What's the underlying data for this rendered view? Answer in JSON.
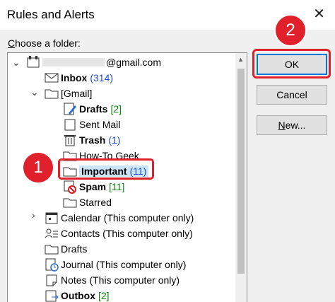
{
  "window": {
    "title": "Rules and Alerts"
  },
  "choose_label": {
    "text_underlined": "C",
    "text_rest": "hoose a folder:"
  },
  "tree": {
    "account": {
      "suffix": "@gmail.com"
    },
    "inbox": {
      "label": "Inbox",
      "count": "(314)"
    },
    "gmail": {
      "label": "[Gmail]"
    },
    "drafts_gmail": {
      "label": "Drafts",
      "count": "[2]"
    },
    "sent_mail": {
      "label": "Sent Mail"
    },
    "trash": {
      "label": "Trash",
      "count": "(1)"
    },
    "howtogeek": {
      "label": "How-To Geek"
    },
    "important": {
      "label": "Important",
      "count": "(11)"
    },
    "spam": {
      "label": "Spam",
      "count": "[11]"
    },
    "starred": {
      "label": "Starred"
    },
    "calendar": {
      "label": "Calendar (This computer only)"
    },
    "contacts": {
      "label": "Contacts (This computer only)"
    },
    "drafts": {
      "label": "Drafts"
    },
    "journal": {
      "label": "Journal (This computer only)"
    },
    "notes": {
      "label": "Notes (This computer only)"
    },
    "outbox": {
      "label": "Outbox",
      "count": "[2]"
    }
  },
  "buttons": {
    "ok": "OK",
    "cancel": "Cancel",
    "new_underlined": "N",
    "new_rest": "ew..."
  },
  "callouts": {
    "one": "1",
    "two": "2"
  },
  "colors": {
    "highlight_red": "#e0202a",
    "count_blue": "#1a4fd6",
    "count_green": "#0a8a0a",
    "ok_focus": "#0078d7"
  }
}
